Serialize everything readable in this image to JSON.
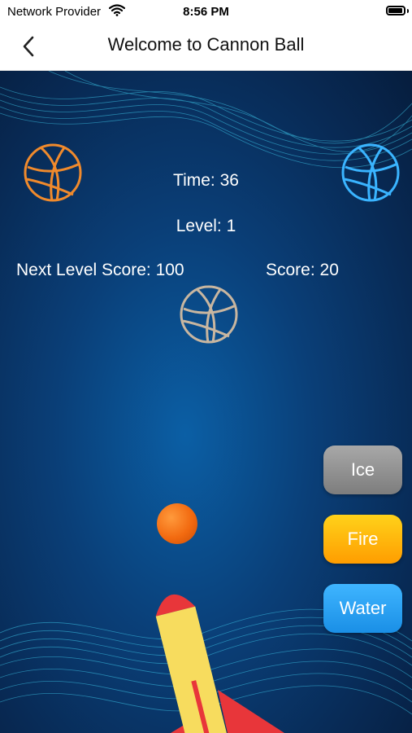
{
  "status": {
    "carrier": "Network Provider",
    "time": "8:56 PM"
  },
  "nav": {
    "title": "Welcome to Cannon Ball"
  },
  "hud": {
    "time": "Time: 36",
    "level": "Level: 1",
    "next_level_score": "Next Level Score: 100",
    "score": "Score: 20"
  },
  "buttons": {
    "ice": "Ice",
    "fire": "Fire",
    "water": "Water"
  },
  "colors": {
    "background": "#0a3f78",
    "orange_target": "#f08a2c",
    "blue_target": "#3ab4ff",
    "beige_target": "#c8b6a0"
  }
}
